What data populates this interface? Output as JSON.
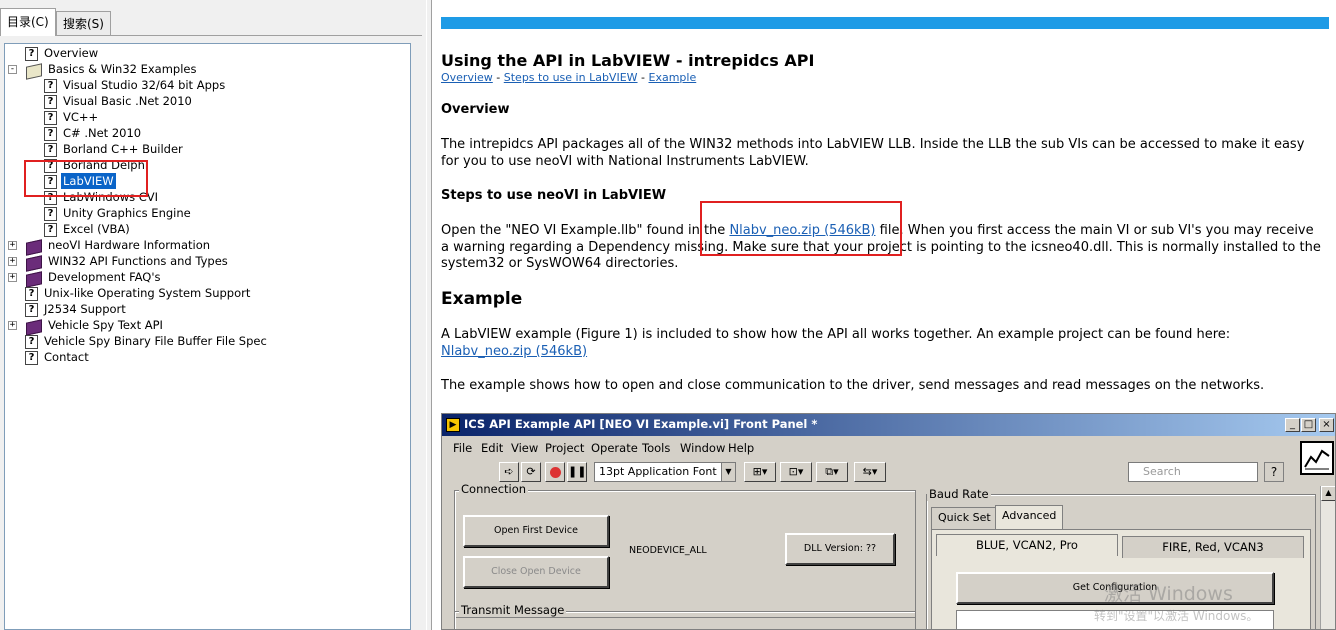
{
  "left_pane": {
    "tabs": [
      {
        "label": "目录(C)",
        "active": true
      },
      {
        "label": "搜索(S)",
        "active": false
      }
    ],
    "tree": [
      {
        "label": "Overview",
        "icon": "help-page-icon",
        "depth": 1,
        "expander": null
      },
      {
        "label": "Basics & Win32 Examples",
        "icon": "open-book-icon",
        "depth": 0,
        "expander": "-"
      },
      {
        "label": "Visual Studio 32/64 bit Apps",
        "icon": "help-page-icon",
        "depth": 2,
        "expander": null
      },
      {
        "label": "Visual Basic .Net 2010",
        "icon": "help-page-icon",
        "depth": 2,
        "expander": null
      },
      {
        "label": "VC++",
        "icon": "help-page-icon",
        "depth": 2,
        "expander": null
      },
      {
        "label": "C# .Net 2010",
        "icon": "help-page-icon",
        "depth": 2,
        "expander": null
      },
      {
        "label": "Borland C++ Builder",
        "icon": "help-page-icon",
        "depth": 2,
        "expander": null
      },
      {
        "label": "Borland Delphi",
        "icon": "help-page-icon",
        "depth": 2,
        "expander": null
      },
      {
        "label": "LabVIEW",
        "icon": "help-page-icon",
        "depth": 2,
        "expander": null,
        "selected": true
      },
      {
        "label": "LabWindows CVI",
        "icon": "help-page-icon",
        "depth": 2,
        "expander": null
      },
      {
        "label": "Unity Graphics Engine",
        "icon": "help-page-icon",
        "depth": 2,
        "expander": null
      },
      {
        "label": "Excel (VBA)",
        "icon": "help-page-icon",
        "depth": 2,
        "expander": null
      },
      {
        "label": "neoVI Hardware Information",
        "icon": "book-icon",
        "depth": 0,
        "expander": "+"
      },
      {
        "label": "WIN32 API Functions and Types",
        "icon": "book-icon",
        "depth": 0,
        "expander": "+"
      },
      {
        "label": "Development FAQ's",
        "icon": "book-icon",
        "depth": 0,
        "expander": "+"
      },
      {
        "label": "Unix-like Operating System Support",
        "icon": "help-page-icon",
        "depth": 1,
        "expander": null
      },
      {
        "label": "J2534 Support",
        "icon": "help-page-icon",
        "depth": 1,
        "expander": null
      },
      {
        "label": "Vehicle Spy Text API",
        "icon": "book-icon",
        "depth": 0,
        "expander": "+"
      },
      {
        "label": "Vehicle Spy Binary File Buffer File Spec",
        "icon": "help-page-icon",
        "depth": 1,
        "expander": null
      },
      {
        "label": "Contact",
        "icon": "help-page-icon",
        "depth": 1,
        "expander": null
      }
    ]
  },
  "doc": {
    "accent_color": "#1e9be6",
    "title": "Using the API in LabVIEW - intrepidcs API",
    "breadcrumbs": {
      "overview": "Overview",
      "steps": "Steps to use in LabVIEW",
      "example": "Example",
      "sep": " - "
    },
    "overview_heading": "Overview",
    "overview_text": "The intrepidcs API packages all of the WIN32 methods into LabVIEW LLB. Inside the LLB the sub VIs can be accessed to make it easy for you to use neoVI with National Instruments LabVIEW.",
    "steps_heading": "Steps to use neoVI in LabVIEW",
    "steps_text_before": "Open the \"NEO VI Example.llb\" found in the ",
    "steps_link": "Nlabv_neo.zip (546kB)",
    "steps_text_after": " file.  When you first access the main VI or sub VI's you may receive a warning regarding a Dependency missing.  Make sure that your project is pointing to the icsneo40.dll.  This is normally installed to the system32 or SysWOW64 directories.",
    "example_heading": "Example",
    "example_text": "A LabVIEW example (Figure 1) is included to show how the API all works together.  An example project can be found here:",
    "example_link": "Nlabv_neo.zip (546kB)",
    "example_text2": "The example shows how to open and close communication to the driver, send messages and read messages on the networks."
  },
  "labview": {
    "window_title": "ICS API Example API [NEO VI Example.vi] Front Panel *",
    "window_buttons": [
      "_",
      "□",
      "×"
    ],
    "menu": [
      "File",
      "Edit",
      "View",
      "Project",
      "Operate",
      "Tools",
      "Window",
      "Help"
    ],
    "font_select": "13pt Application Font",
    "search_placeholder": "Search",
    "help_button": "?",
    "connection_label": "Connection",
    "open_first_device": "Open First Device",
    "close_open_device": "Close Open Device",
    "device_const": "NEODEVICE_ALL",
    "dll_version": "DLL Version: ??",
    "transmit_label": "Transmit Message",
    "baud_label": "Baud Rate",
    "baud_tabs": [
      "Quick Set",
      "Advanced"
    ],
    "device_tabs": [
      "BLUE, VCAN2, Pro",
      "FIRE, Red, VCAN3"
    ],
    "get_configuration": "Get Configuration",
    "watermark": "激活 Windows",
    "watermark2": "转到\"设置\"以激活 Windows。"
  }
}
